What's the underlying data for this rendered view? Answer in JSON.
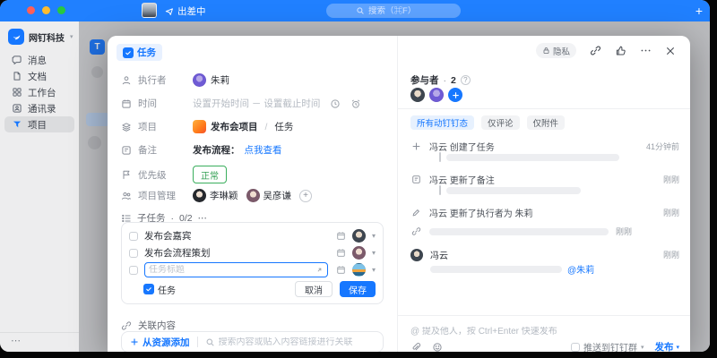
{
  "titlebar": {
    "status": "出差中",
    "search_placeholder": "搜索（⌘F）",
    "plus": "+"
  },
  "sidebar": {
    "team": "网钉科技",
    "team_caret": "▾",
    "items": [
      {
        "label": "消息"
      },
      {
        "label": "文档"
      },
      {
        "label": "工作台"
      },
      {
        "label": "通讯录"
      },
      {
        "label": "项目"
      }
    ],
    "more": "⋯",
    "bg_logo": "T"
  },
  "modal": {
    "type_badge": "任务",
    "privacy": "隐私",
    "fields": {
      "executor": {
        "label": "执行者",
        "value": "朱莉"
      },
      "time": {
        "label": "时间",
        "placeholder": "设置开始时间 － 设置截止时间"
      },
      "project": {
        "label": "项目",
        "value": "发布会项目",
        "divider": "/",
        "sub": "任务"
      },
      "note": {
        "label": "备注",
        "text": "发布流程：",
        "link": "点我查看"
      },
      "priority": {
        "label": "优先级",
        "value": "正常"
      },
      "managers": {
        "label": "项目管理",
        "people": [
          {
            "name": "李琳颖"
          },
          {
            "name": "吴彦谦"
          }
        ],
        "add": "+"
      }
    },
    "subtasks": {
      "title": "子任务",
      "sep": "·",
      "count": "0/2",
      "more": "⋯",
      "items": [
        {
          "title": "发布会嘉宾"
        },
        {
          "title": "发布会流程策划"
        }
      ],
      "input_placeholder": "任务标题",
      "type_label": "任务",
      "cancel": "取消",
      "save": "保存"
    },
    "related": {
      "title": "关联内容",
      "add": "从资源添加",
      "search_placeholder": "搜索内容或贴入内容链接进行关联"
    }
  },
  "panel": {
    "participants": {
      "label": "参与者",
      "sep": "·",
      "count": "2",
      "help": "?",
      "add": "+"
    },
    "tabs": [
      {
        "label": "所有动钉钉态"
      },
      {
        "label": "仅评论"
      },
      {
        "label": "仅附件"
      }
    ],
    "feed": [
      {
        "text": "冯云 创建了任务",
        "time": "41分钟前"
      },
      {
        "text": "冯云 更新了备注",
        "time": "刚刚"
      },
      {
        "text": "冯云 更新了执行者为 朱莉",
        "time": "刚刚"
      },
      {
        "text": "",
        "time": "刚刚"
      },
      {
        "name": "冯云",
        "time": "刚刚",
        "mention": "@朱莉"
      }
    ],
    "composer": {
      "placeholder": "@ 提及他人，按 Ctrl+Enter 快速发布",
      "push": "推送到钉钉群",
      "publish": "发布"
    }
  }
}
